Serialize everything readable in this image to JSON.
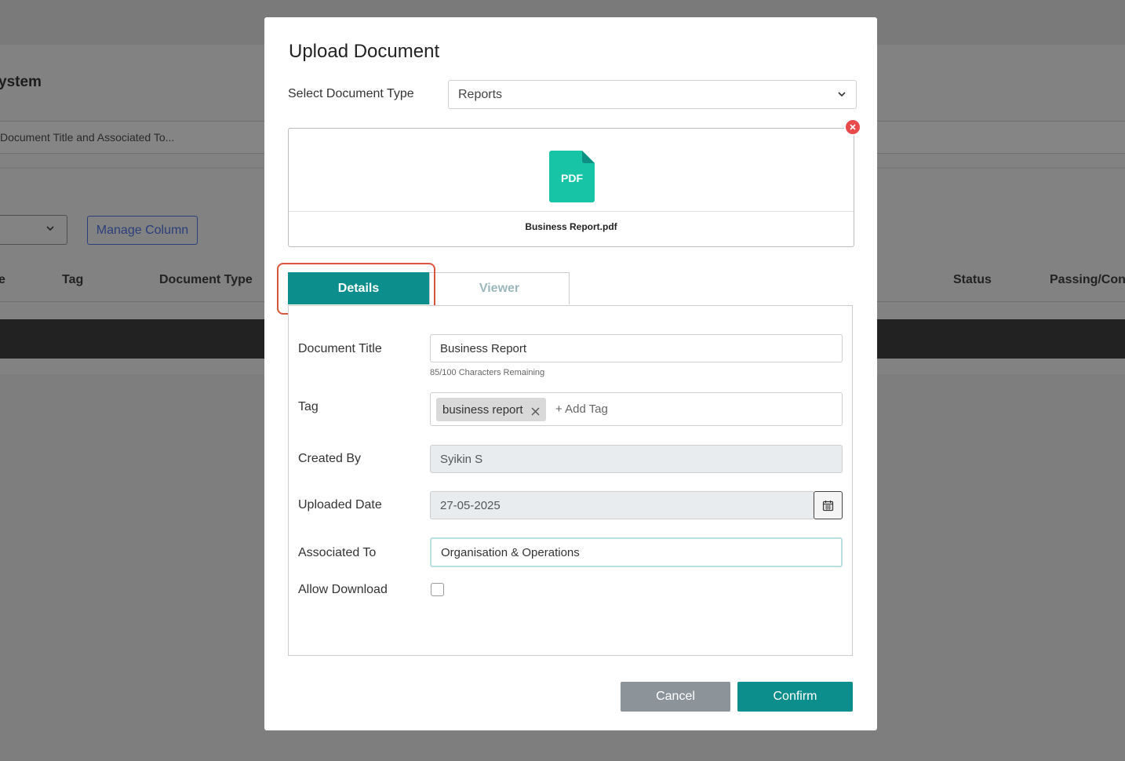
{
  "background": {
    "page_title_fragment": "ystem",
    "search_placeholder_fragment": "Document Title and Associated To...",
    "manage_column_label": "Manage Column",
    "table_headers": [
      "e",
      "Tag",
      "Document Type",
      "Status",
      "Passing/Con"
    ]
  },
  "modal": {
    "title": "Upload Document",
    "document_type": {
      "label": "Select Document Type",
      "value": "Reports"
    },
    "file": {
      "icon_text": "PDF",
      "name": "Business Report.pdf"
    },
    "tabs": [
      {
        "label": "Details",
        "active": true
      },
      {
        "label": "Viewer",
        "active": false
      }
    ],
    "fields": {
      "document_title": {
        "label": "Document Title",
        "value": "Business Report",
        "helper": "85/100 Characters Remaining"
      },
      "tag": {
        "label": "Tag",
        "chips": [
          "business report"
        ],
        "add_placeholder": "+ Add Tag"
      },
      "created_by": {
        "label": "Created By",
        "value": "Syikin S"
      },
      "uploaded_date": {
        "label": "Uploaded Date",
        "value": "27-05-2025"
      },
      "associated_to": {
        "label": "Associated To",
        "value": "Organisation & Operations"
      },
      "allow_download": {
        "label": "Allow Download",
        "checked": false
      }
    },
    "buttons": {
      "cancel": "Cancel",
      "confirm": "Confirm"
    }
  },
  "colors": {
    "accent": "#0c8f8c",
    "highlight": "#d9553f",
    "remove": "#e8494a",
    "pdf_icon": "#17c4a5"
  },
  "icons": [
    "chevron-down-icon",
    "pdf-file-icon",
    "remove-icon",
    "close-icon",
    "calendar-icon"
  ]
}
